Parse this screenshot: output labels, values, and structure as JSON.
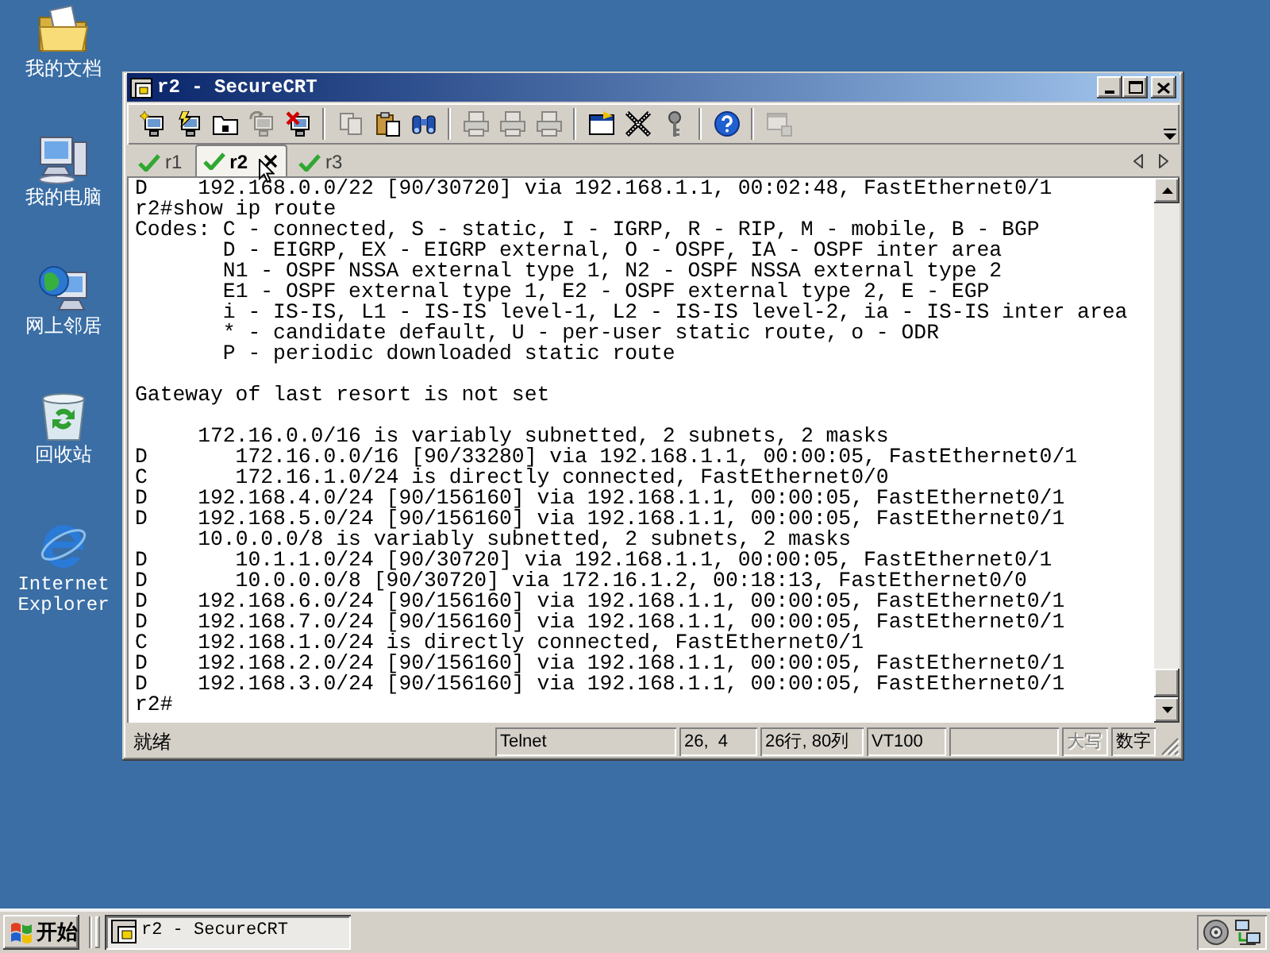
{
  "desktop": {
    "icons": [
      {
        "label": "我的文档"
      },
      {
        "label": "我的电脑"
      },
      {
        "label": "网上邻居"
      },
      {
        "label": "回收站"
      },
      {
        "label": "Internet Explorer"
      }
    ]
  },
  "window": {
    "title": "r2 - SecureCRT"
  },
  "toolbar": {
    "groups": [
      [
        {
          "disabled": false
        },
        {
          "disabled": false
        },
        {
          "disabled": false
        },
        {
          "disabled": true
        },
        {
          "disabled": false
        }
      ],
      [
        {
          "disabled": true
        },
        {
          "disabled": false
        },
        {
          "disabled": false
        }
      ],
      [
        {
          "disabled": true
        },
        {
          "disabled": true
        },
        {
          "disabled": true
        }
      ],
      [
        {
          "disabled": false
        },
        {
          "disabled": false
        },
        {
          "disabled": false
        }
      ],
      [
        {
          "disabled": false
        }
      ],
      [
        {
          "disabled": true
        }
      ]
    ]
  },
  "tabs": [
    {
      "label": "r1",
      "selected": false,
      "connected": true
    },
    {
      "label": "r2",
      "selected": true,
      "connected": true
    },
    {
      "label": "r3",
      "selected": false,
      "connected": true
    }
  ],
  "terminal": {
    "blocks": [
      [
        "D    192.168.0.0/22 [90/30720] via 192.168.1.1, 00:02:48, FastEthernet0/1",
        "r2#show ip route",
        "Codes: C - connected, S - static, I - IGRP, R - RIP, M - mobile, B - BGP",
        "       D - EIGRP, EX - EIGRP external, O - OSPF, IA - OSPF inter area",
        "       N1 - OSPF NSSA external type 1, N2 - OSPF NSSA external type 2",
        "       E1 - OSPF external type 1, E2 - OSPF external type 2, E - EGP",
        "       i - IS-IS, L1 - IS-IS level-1, L2 - IS-IS level-2, ia - IS-IS inter area",
        "       * - candidate default, U - per-user static route, o - ODR",
        "       P - periodic downloaded static route"
      ],
      [
        "Gateway of last resort is not set"
      ],
      [
        "     172.16.0.0/16 is variably subnetted, 2 subnets, 2 masks",
        "D       172.16.0.0/16 [90/33280] via 192.168.1.1, 00:00:05, FastEthernet0/1",
        "C       172.16.1.0/24 is directly connected, FastEthernet0/0",
        "D    192.168.4.0/24 [90/156160] via 192.168.1.1, 00:00:05, FastEthernet0/1",
        "D    192.168.5.0/24 [90/156160] via 192.168.1.1, 00:00:05, FastEthernet0/1",
        "     10.0.0.0/8 is variably subnetted, 2 subnets, 2 masks",
        "D       10.1.1.0/24 [90/30720] via 192.168.1.1, 00:00:05, FastEthernet0/1",
        "D       10.0.0.0/8 [90/30720] via 172.16.1.2, 00:18:13, FastEthernet0/0",
        "D    192.168.6.0/24 [90/156160] via 192.168.1.1, 00:00:05, FastEthernet0/1",
        "D    192.168.7.0/24 [90/156160] via 192.168.1.1, 00:00:05, FastEthernet0/1",
        "C    192.168.1.0/24 is directly connected, FastEthernet0/1",
        "D    192.168.2.0/24 [90/156160] via 192.168.1.1, 00:00:05, FastEthernet0/1",
        "D    192.168.3.0/24 [90/156160] via 192.168.1.1, 00:00:05, FastEthernet0/1",
        "r2#"
      ]
    ]
  },
  "status_bar": {
    "message": "就绪",
    "panes": [
      {
        "kind": "text",
        "text": "Telnet",
        "disabled": false
      },
      {
        "kind": "text",
        "text": "26,  4",
        "disabled": false
      },
      {
        "kind": "text",
        "text": "26行, 80列",
        "disabled": false
      },
      {
        "kind": "text",
        "text": "VT100",
        "disabled": false
      },
      {
        "kind": "blank"
      },
      {
        "kind": "text",
        "text": "大写",
        "disabled": true
      },
      {
        "kind": "text",
        "text": "数字",
        "disabled": false
      }
    ]
  },
  "taskbar": {
    "start_label": "开始",
    "tasks": [
      {
        "label": "r2 - SecureCRT",
        "selected": true
      }
    ]
  }
}
